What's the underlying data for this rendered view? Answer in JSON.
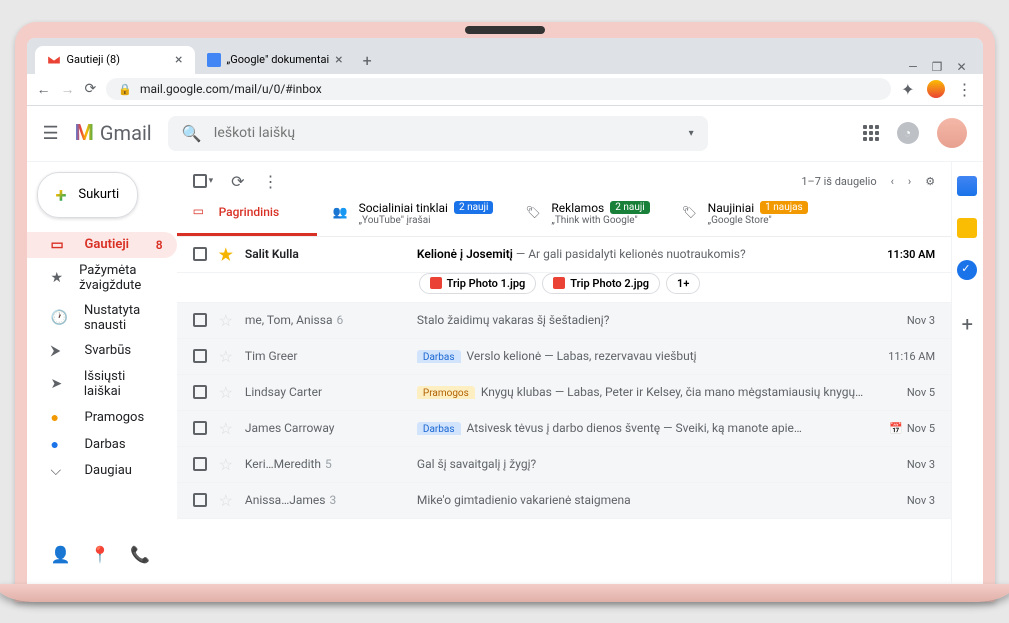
{
  "browser": {
    "tabs": [
      {
        "title": "Gautieji (8)"
      },
      {
        "title": "„Google\" dokumentai"
      }
    ],
    "url": "mail.google.com/mail/u/0/#inbox"
  },
  "header": {
    "logo_text": "Gmail",
    "search_placeholder": "Ieškoti laiškų"
  },
  "sidebar": {
    "compose": "Sukurti",
    "items": [
      {
        "label": "Gautieji",
        "count": "8",
        "icon": "▢"
      },
      {
        "label": "Pažymėta žvaigždute",
        "icon": "★"
      },
      {
        "label": "Nustatyta snausti",
        "icon": "🕐"
      },
      {
        "label": "Svarbūs",
        "icon": "➤"
      },
      {
        "label": "Išsiųsti laiškai",
        "icon": "➤"
      },
      {
        "label": "Pramogos",
        "icon": "●"
      },
      {
        "label": "Darbas",
        "icon": "●"
      },
      {
        "label": "Daugiau",
        "icon": "⌵"
      }
    ]
  },
  "toolbar": {
    "pagination": "1–7 iš daugelio"
  },
  "categories": [
    {
      "title": "Pagrindinis"
    },
    {
      "title": "Socialiniai tinklai",
      "badge": "2 nauji",
      "sub": "„YouTube\" įrašai"
    },
    {
      "title": "Reklamos",
      "badge": "2 nauji",
      "sub": "„Think with Google\""
    },
    {
      "title": "Naujiniai",
      "badge": "1 naujas",
      "sub": "„Google Store\""
    }
  ],
  "emails": [
    {
      "sender": "Salit Kulla",
      "subject": "Kelionė į Josemitį",
      "preview": "Ar gali pasidalyti kelionės nuotraukomis?",
      "date": "11:30 AM",
      "starred": true,
      "unread": true,
      "attachments": [
        "Trip Photo 1.jpg",
        "Trip Photo 2.jpg"
      ],
      "more": "1+"
    },
    {
      "sender": "me, Tom, Anissa",
      "sender_count": "6",
      "subject": "Stalo žaidimų vakaras šį šeštadienį?",
      "date": "Nov 3"
    },
    {
      "sender": "Tim Greer",
      "label": "Darbas",
      "label_class": "darbas",
      "subject": "Verslo kelionė",
      "preview": "Labas, rezervavau viešbutį",
      "date": "11:16 AM"
    },
    {
      "sender": "Lindsay Carter",
      "label": "Pramogos",
      "label_class": "pramogos",
      "subject": "Knygų klubas",
      "preview": "Labas, Peter ir Kelsey, čia mano mėgstamiausių knygų…",
      "date": "Nov 5"
    },
    {
      "sender": "James Carroway",
      "label": "Darbas",
      "label_class": "darbas",
      "subject": "Atsivesk tėvus į darbo dienos šventę",
      "preview": "Sveiki, ką manote apie…",
      "date": "Nov 5",
      "event": true
    },
    {
      "sender": "Keri…Meredith",
      "sender_count": "5",
      "subject": "Gal šį savaitgalį į žygį?",
      "date": "Nov 3"
    },
    {
      "sender": "Anissa…James",
      "sender_count": "3",
      "subject": "Mike'o gimtadienio vakarienė staigmena",
      "date": "Nov 3"
    }
  ]
}
